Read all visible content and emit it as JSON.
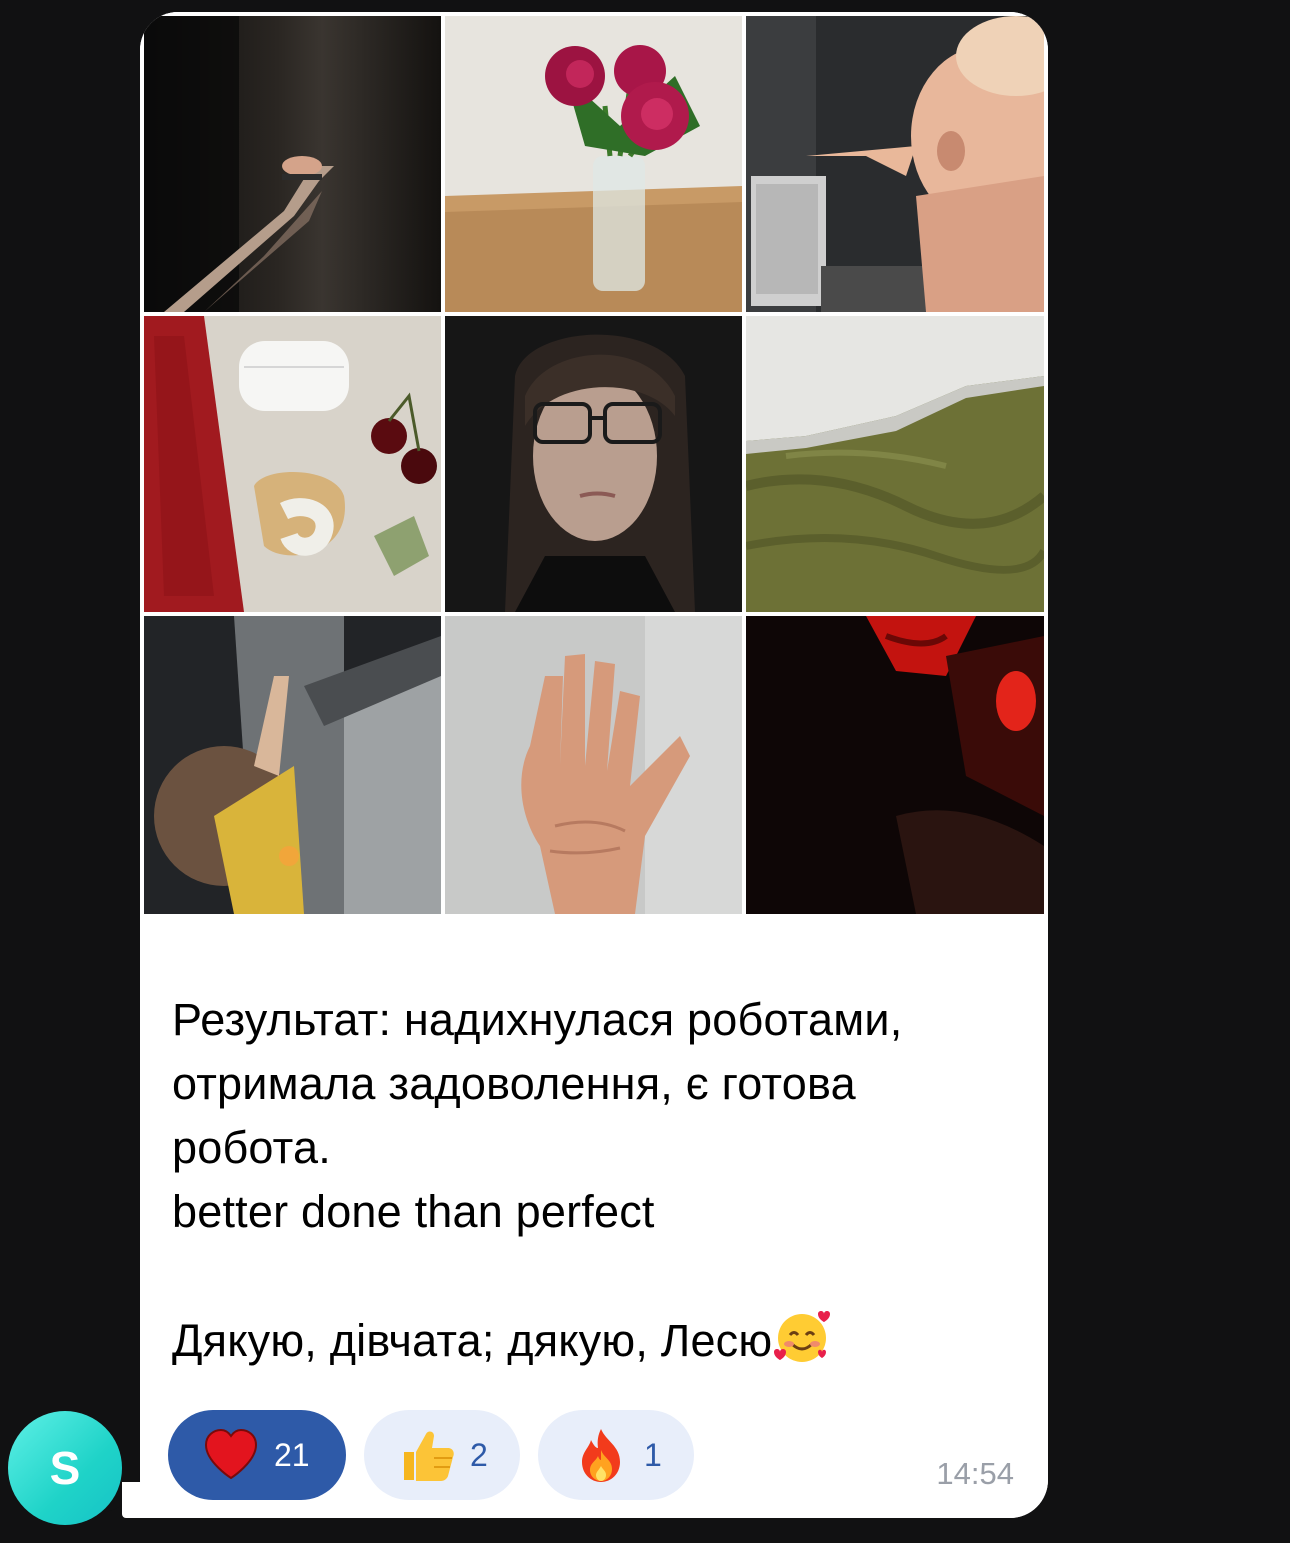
{
  "message": {
    "photos": [
      {
        "name": "photo-foot-shadow"
      },
      {
        "name": "photo-peonies-vase"
      },
      {
        "name": "photo-baby-reaching"
      },
      {
        "name": "photo-airpods-cherries-teether"
      },
      {
        "name": "photo-woman-portrait"
      },
      {
        "name": "photo-olive-bedsheet"
      },
      {
        "name": "photo-baby-fridge"
      },
      {
        "name": "photo-hand-palm"
      },
      {
        "name": "photo-red-light-portrait"
      }
    ],
    "caption": {
      "line1": "Результат: надихнулася роботами,",
      "line2": "отримала задоволення, є готова",
      "line3": "робота.",
      "line4": "better done than perfect",
      "line5": "Дякую, дівчата; дякую, Лесю"
    },
    "reactions": [
      {
        "emoji": "heart",
        "count": "21",
        "active": true
      },
      {
        "emoji": "thumbs-up",
        "count": "2",
        "active": false
      },
      {
        "emoji": "fire",
        "count": "1",
        "active": false
      }
    ],
    "time": "14:54"
  },
  "sender": {
    "avatar_letter": "S"
  },
  "colors": {
    "background": "#111112",
    "bubble": "#ffffff",
    "reaction_active": "#2e5aa8",
    "reaction_inactive": "#e8eefa",
    "avatar": "#1fd3c8"
  }
}
